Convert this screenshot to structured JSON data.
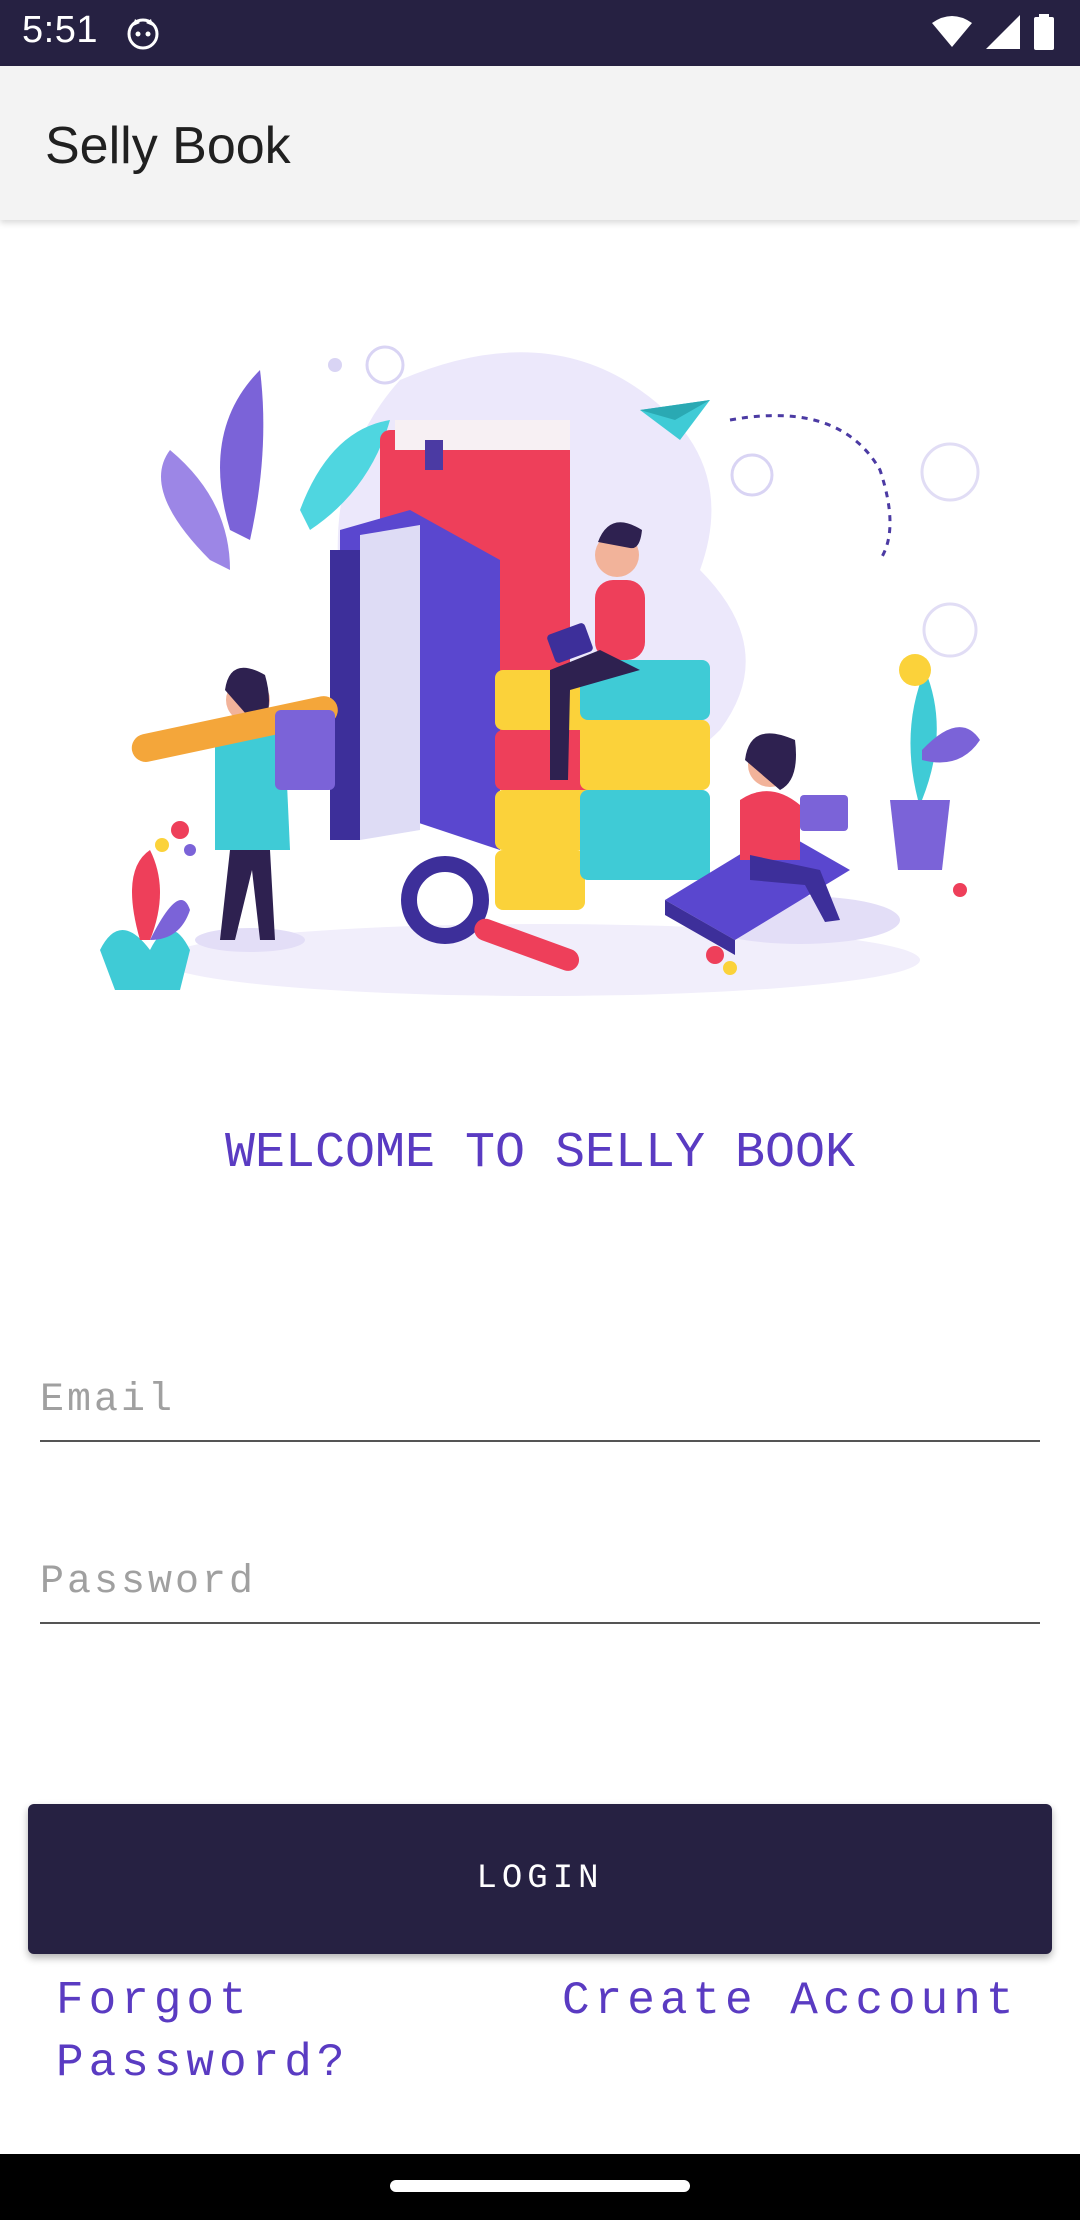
{
  "status_bar": {
    "time": "5:51",
    "icons": [
      "cat-notification-icon",
      "wifi-icon",
      "cell-signal-icon",
      "battery-icon"
    ]
  },
  "app_bar": {
    "title": "Selly Book"
  },
  "illustration": {
    "icon": "reading-books-illustration"
  },
  "welcome": "WELCOME TO SELLY BOOK",
  "form": {
    "email_placeholder": "Email",
    "password_placeholder": "Password",
    "login_label": "LOGIN"
  },
  "links": {
    "forgot_password": "Forgot Password?",
    "create_account": "Create Account"
  },
  "colors": {
    "primary_dark": "#262142",
    "accent_purple": "#5a3bc2",
    "app_bar_bg": "#f3f3f3"
  }
}
